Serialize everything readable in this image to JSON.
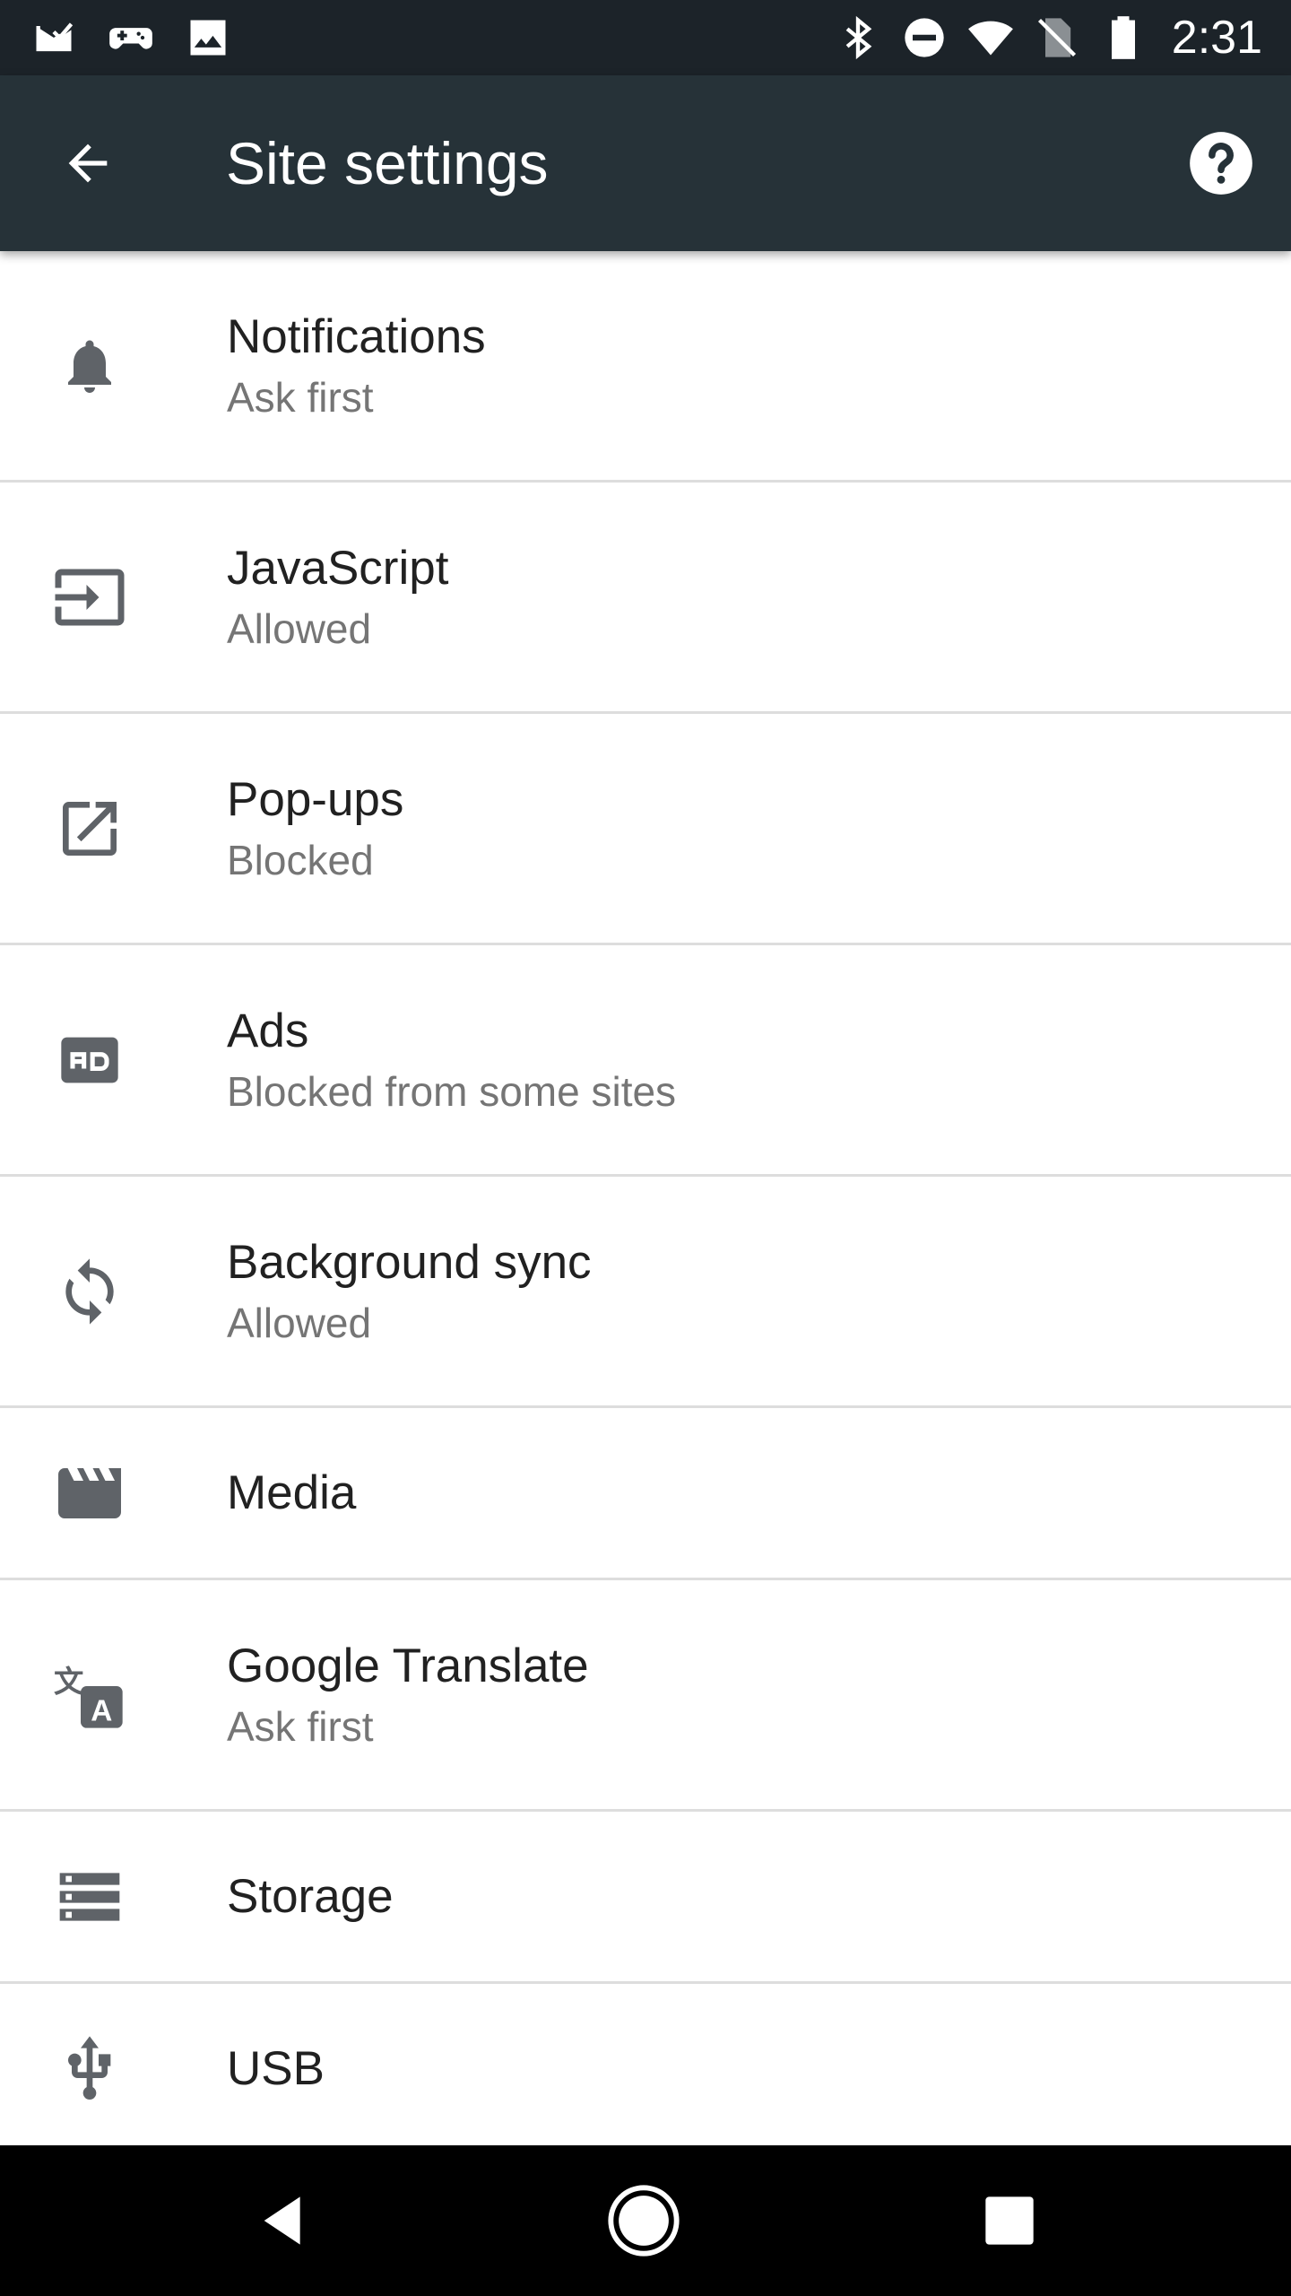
{
  "status_bar": {
    "time": "2:31",
    "left_icons": [
      "mail-check-icon",
      "game-controller-icon",
      "image-icon"
    ],
    "right_icons": [
      "bluetooth-icon",
      "do-not-disturb-icon",
      "wifi-icon",
      "no-sim-icon",
      "battery-icon"
    ]
  },
  "app_bar": {
    "title": "Site settings",
    "back_icon": "arrow-back-icon",
    "help_icon": "help-icon"
  },
  "settings": [
    {
      "icon": "bell-icon",
      "title": "Notifications",
      "subtitle": "Ask first"
    },
    {
      "icon": "javascript-icon",
      "title": "JavaScript",
      "subtitle": "Allowed"
    },
    {
      "icon": "open-in-new-icon",
      "title": "Pop-ups",
      "subtitle": "Blocked"
    },
    {
      "icon": "ads-icon",
      "title": "Ads",
      "subtitle": "Blocked from some sites"
    },
    {
      "icon": "sync-icon",
      "title": "Background sync",
      "subtitle": "Allowed"
    },
    {
      "icon": "media-icon",
      "title": "Media"
    },
    {
      "icon": "translate-icon",
      "title": "Google Translate",
      "subtitle": "Ask first"
    },
    {
      "icon": "storage-icon",
      "title": "Storage"
    },
    {
      "icon": "usb-icon",
      "title": "USB"
    }
  ],
  "nav_bar": {
    "icons": [
      "nav-back-icon",
      "nav-home-icon",
      "nav-recents-icon"
    ]
  },
  "colors": {
    "status_bar": "#1c2329",
    "app_bar": "#263238",
    "icon": "#5f6368",
    "title_text": "#212121",
    "subtitle_text": "#757575",
    "divider": "#dddddd"
  }
}
